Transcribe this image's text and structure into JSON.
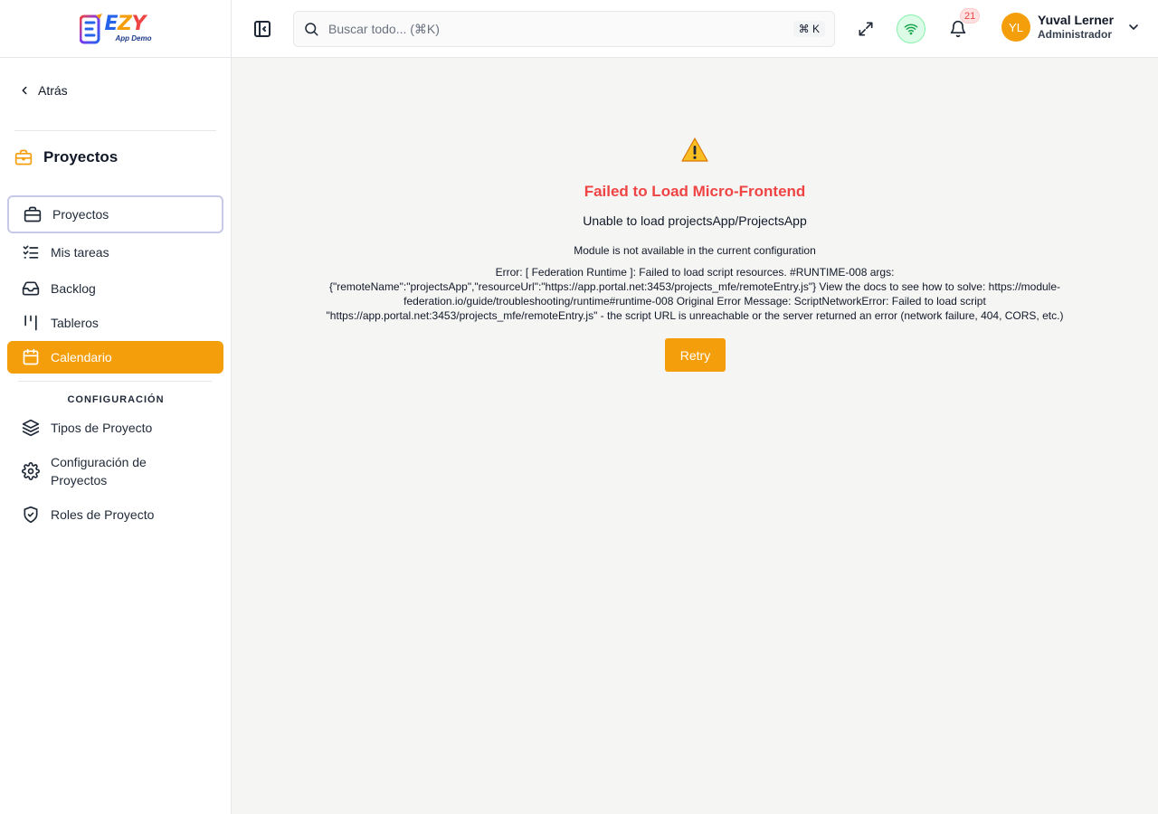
{
  "brand": {
    "logo_letter": "E",
    "logo_word_1": "E",
    "logo_word_2": "Z",
    "logo_word_3": "Y",
    "subtitle": "App Demo"
  },
  "header": {
    "search_placeholder": "Buscar todo... (⌘K)",
    "search_shortcut": "⌘ K",
    "notifications_count": "21",
    "user": {
      "initials": "YL",
      "name": "Yuval Lerner",
      "role": "Administrador"
    }
  },
  "sidebar": {
    "back_label": "Atrás",
    "section_title": "Proyectos",
    "items": [
      {
        "label": "Proyectos",
        "icon": "briefcase-icon"
      },
      {
        "label": "Mis tareas",
        "icon": "checklist-icon"
      },
      {
        "label": "Backlog",
        "icon": "inbox-icon"
      },
      {
        "label": "Tableros",
        "icon": "columns-icon"
      },
      {
        "label": "Calendario",
        "icon": "calendar-icon"
      }
    ],
    "config_label": "CONFIGURACIÓN",
    "config_items": [
      {
        "label": "Tipos de Proyecto",
        "icon": "layers-icon"
      },
      {
        "label": "Configuración de Proyectos",
        "icon": "gear-icon"
      },
      {
        "label": "Roles de Proyecto",
        "icon": "shield-check-icon"
      }
    ]
  },
  "error": {
    "title": "Failed to Load Micro-Frontend",
    "subtitle": "Unable to load projectsApp/ProjectsApp",
    "module_message": "Module is not available in the current configuration",
    "detail": "Error: [ Federation Runtime ]: Failed to load script resources. #RUNTIME-008 args: {\"remoteName\":\"projectsApp\",\"resourceUrl\":\"https://app.portal.net:3453/projects_mfe/remoteEntry.js\"} View the docs to see how to solve: https://module-federation.io/guide/troubleshooting/runtime#runtime-008 Original Error Message: ScriptNetworkError: Failed to load script \"https://app.portal.net:3453/projects_mfe/remoteEntry.js\" - the script URL is unreachable or the server returned an error (network failure, 404, CORS, etc.)",
    "retry_label": "Retry"
  },
  "colors": {
    "accent": "#f59e0b",
    "error": "#ef4444",
    "success_bg": "#dcfce7"
  }
}
